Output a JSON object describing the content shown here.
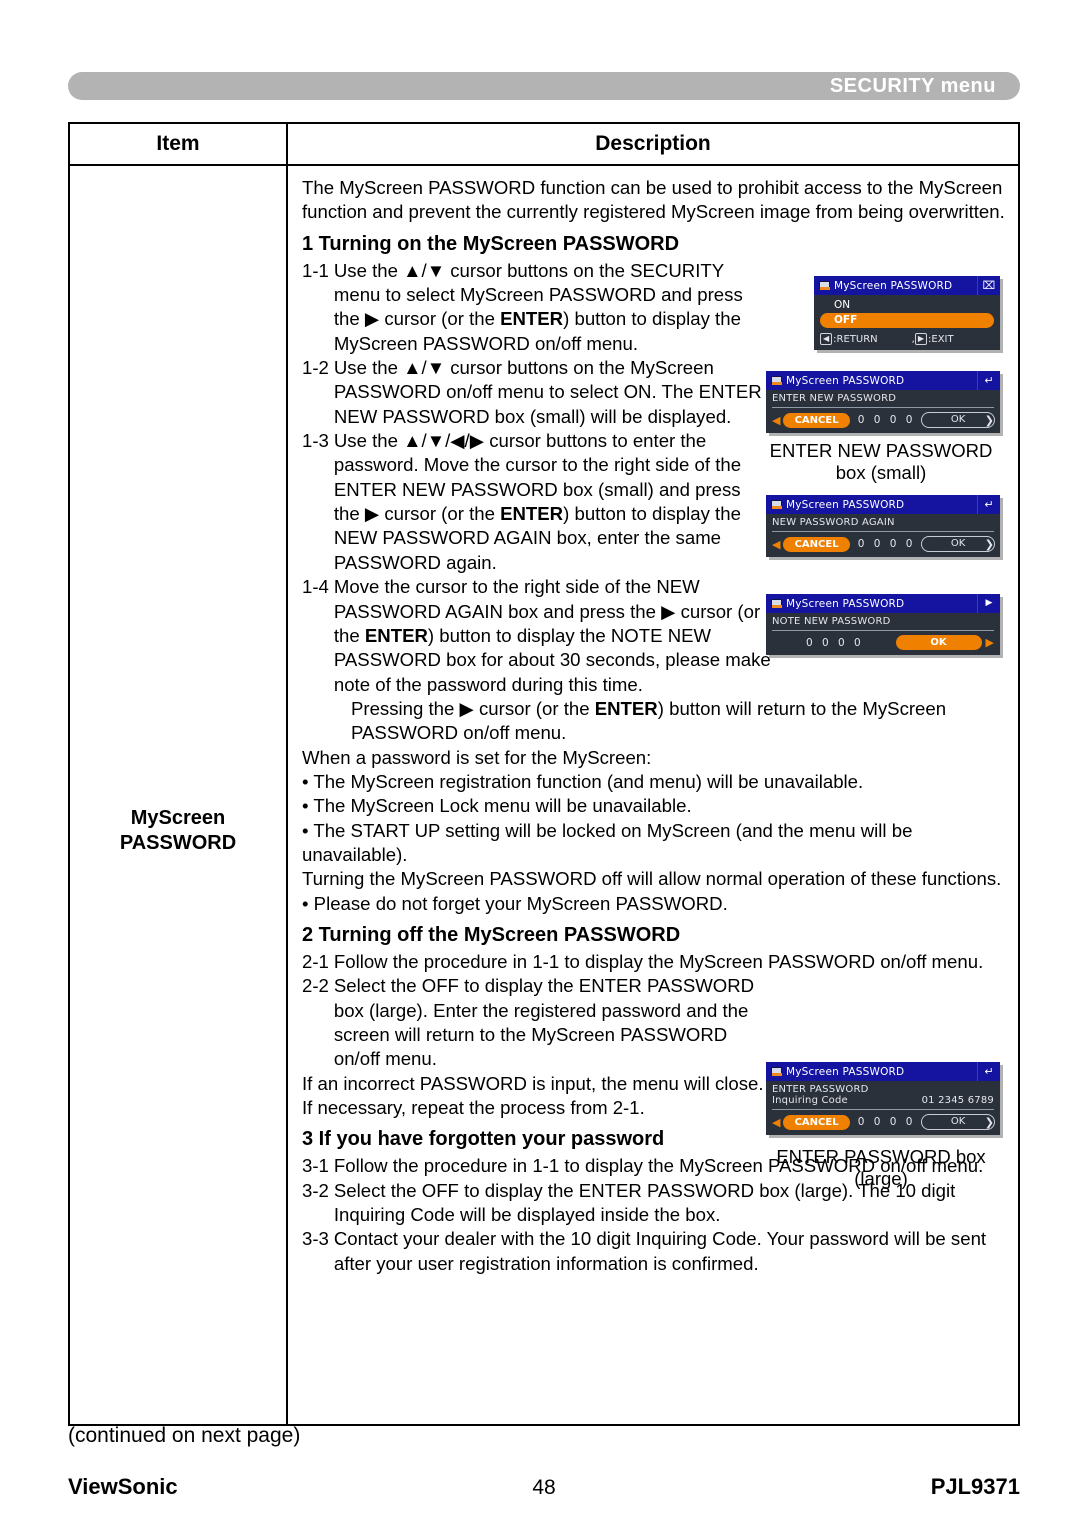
{
  "header": {
    "banner_title": "SECURITY menu"
  },
  "table": {
    "columns": {
      "item": "Item",
      "description": "Description"
    },
    "item_label_line1": "MyScreen",
    "item_label_line2": "PASSWORD"
  },
  "description": {
    "intro": "The MyScreen PASSWORD function can be used to prohibit access to the MyScreen function and prevent the currently registered MyScreen image from being overwritten.",
    "section1": {
      "heading": "1 Turning on the MyScreen PASSWORD",
      "step_1_1_num": "1-1",
      "step_1_1_text_a": "Use the ▲/▼ cursor buttons on the SECURITY menu to select MyScreen PASSWORD and press the ▶ cursor (or the ",
      "step_1_1_bold": "ENTER",
      "step_1_1_text_b": ") button to display the MyScreen PASSWORD on/off menu.",
      "step_1_2_num": "1-2",
      "step_1_2_text": "Use the ▲/▼ cursor buttons on the MyScreen PASSWORD on/off menu to select ON. The ENTER NEW PASSWORD box (small) will be displayed.",
      "step_1_3_num": "1-3",
      "step_1_3_text_a": "Use the ▲/▼/◀/▶ cursor buttons to enter the password. Move the cursor to the right side of the ENTER NEW PASSWORD box (small) and press the ▶ cursor (or the ",
      "step_1_3_bold": "ENTER",
      "step_1_3_text_b": ") button to display the NEW PASSWORD AGAIN box, enter the same PASSWORD again.",
      "step_1_4_num": "1-4",
      "step_1_4_text_a": "Move the cursor to the right side of the NEW PASSWORD AGAIN box and press the ▶ cursor (or the ",
      "step_1_4_bold": "ENTER",
      "step_1_4_text_b": ") button to display the NOTE NEW PASSWORD box for about 30 seconds, please make note of the password during this time.",
      "pressing_a": "Pressing the ▶ cursor (or the ",
      "pressing_bold": "ENTER",
      "pressing_b": ") button will return to the MyScreen PASSWORD on/off menu.",
      "when_set": "When a password is set for the MyScreen:",
      "bullets": [
        "• The MyScreen registration function (and menu) will be unavailable.",
        "• The MyScreen Lock menu will be unavailable.",
        "• The START UP setting will be locked on MyScreen (and the menu will be unavailable)."
      ],
      "turning_off_note": "Turning the MyScreen PASSWORD off will allow normal operation of these functions.",
      "forget_bullet": "• Please do not forget your MyScreen PASSWORD."
    },
    "section2": {
      "heading": "2 Turning off the MyScreen PASSWORD",
      "step_2_1_num": "2-1",
      "step_2_1_text": "Follow the procedure in 1-1 to display the MyScreen PASSWORD on/off menu.",
      "step_2_2_num": "2-2",
      "step_2_2_text": "Select the OFF to display the ENTER PASSWORD box (large). Enter the registered password and the screen will return to the MyScreen PASSWORD on/off menu.",
      "incorrect_note": "If an incorrect PASSWORD is input, the menu will close. If necessary, repeat the process from 2-1."
    },
    "section3": {
      "heading": "3 If you have forgotten your password",
      "step_3_1_num": "3-1",
      "step_3_1_text": "Follow the procedure in 1-1 to display the MyScreen PASSWORD on/off menu.",
      "step_3_2_num": "3-2",
      "step_3_2_text": "Select the OFF to display the ENTER PASSWORD box (large). The 10 digit Inquiring Code will be displayed inside the box.",
      "step_3_3_num": "3-3",
      "step_3_3_text": "Contact your dealer with the 10 digit Inquiring Code. Your password will be sent after your user registration information is confirmed."
    }
  },
  "osd": {
    "onoff": {
      "title": "MyScreen PASSWORD",
      "close_glyph": "⌧",
      "option_on": "ON",
      "option_off": "OFF",
      "return_key": "◀",
      "return_label": ":RETURN",
      "exit_sep": ",",
      "exit_key": "▶",
      "exit_label": ":EXIT"
    },
    "enter_new": {
      "title": "MyScreen PASSWORD",
      "btn_glyph": "↵",
      "field_label": "ENTER NEW PASSWORD",
      "left_arrow": "◀",
      "cancel": "CANCEL",
      "digits": "0 0 0 0",
      "ok": "OK",
      "right_arrow": "❯",
      "caption_line1": "ENTER NEW PASSWORD",
      "caption_line2": "box (small)"
    },
    "again": {
      "title": "MyScreen PASSWORD",
      "btn_glyph": "↵",
      "field_label": "NEW PASSWORD AGAIN",
      "left_arrow": "◀",
      "cancel": "CANCEL",
      "digits": "0 0 0 0",
      "ok": "OK",
      "right_arrow": "❯"
    },
    "note": {
      "title": "MyScreen PASSWORD",
      "btn_glyph": "▶",
      "field_label": "NOTE NEW PASSWORD",
      "digits": "0 0 0 0",
      "ok": "OK",
      "right_arrow": "▶"
    },
    "enter_large": {
      "title": "MyScreen PASSWORD",
      "btn_glyph": "↵",
      "field_label": "ENTER PASSWORD",
      "inquiring_label": "Inquiring Code",
      "inquiring_code": "01 2345 6789",
      "left_arrow": "◀",
      "cancel": "CANCEL",
      "digits": "0 0 0 0",
      "ok": "OK",
      "right_arrow": "❯",
      "caption_line1": "ENTER PASSWORD box",
      "caption_line2": "(large)"
    }
  },
  "footer": {
    "continued": "(continued on next page)",
    "brand": "ViewSonic",
    "page_number": "48",
    "model": "PJL9371"
  },
  "colors": {
    "banner_gray": "#b3b3b3",
    "osd_title_blue": "#1414a0",
    "osd_body": "#2b313b",
    "accent_orange": "#f08000"
  }
}
